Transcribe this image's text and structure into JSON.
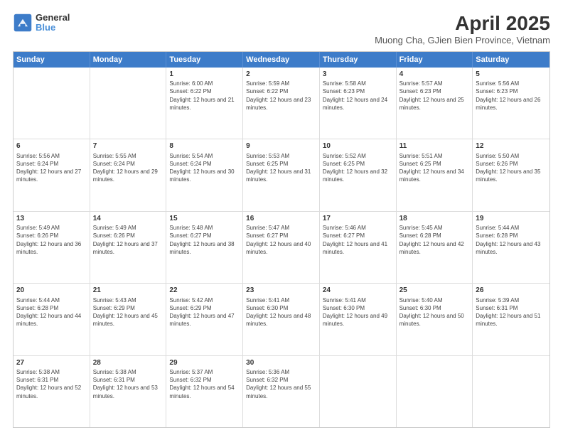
{
  "header": {
    "logo_line1": "General",
    "logo_line2": "Blue",
    "title": "April 2025",
    "subtitle": "Muong Cha, GJien Bien Province, Vietnam"
  },
  "days_of_week": [
    "Sunday",
    "Monday",
    "Tuesday",
    "Wednesday",
    "Thursday",
    "Friday",
    "Saturday"
  ],
  "weeks": [
    [
      {
        "day": "",
        "sunrise": "",
        "sunset": "",
        "daylight": ""
      },
      {
        "day": "",
        "sunrise": "",
        "sunset": "",
        "daylight": ""
      },
      {
        "day": "1",
        "sunrise": "Sunrise: 6:00 AM",
        "sunset": "Sunset: 6:22 PM",
        "daylight": "Daylight: 12 hours and 21 minutes."
      },
      {
        "day": "2",
        "sunrise": "Sunrise: 5:59 AM",
        "sunset": "Sunset: 6:22 PM",
        "daylight": "Daylight: 12 hours and 23 minutes."
      },
      {
        "day": "3",
        "sunrise": "Sunrise: 5:58 AM",
        "sunset": "Sunset: 6:23 PM",
        "daylight": "Daylight: 12 hours and 24 minutes."
      },
      {
        "day": "4",
        "sunrise": "Sunrise: 5:57 AM",
        "sunset": "Sunset: 6:23 PM",
        "daylight": "Daylight: 12 hours and 25 minutes."
      },
      {
        "day": "5",
        "sunrise": "Sunrise: 5:56 AM",
        "sunset": "Sunset: 6:23 PM",
        "daylight": "Daylight: 12 hours and 26 minutes."
      }
    ],
    [
      {
        "day": "6",
        "sunrise": "Sunrise: 5:56 AM",
        "sunset": "Sunset: 6:24 PM",
        "daylight": "Daylight: 12 hours and 27 minutes."
      },
      {
        "day": "7",
        "sunrise": "Sunrise: 5:55 AM",
        "sunset": "Sunset: 6:24 PM",
        "daylight": "Daylight: 12 hours and 29 minutes."
      },
      {
        "day": "8",
        "sunrise": "Sunrise: 5:54 AM",
        "sunset": "Sunset: 6:24 PM",
        "daylight": "Daylight: 12 hours and 30 minutes."
      },
      {
        "day": "9",
        "sunrise": "Sunrise: 5:53 AM",
        "sunset": "Sunset: 6:25 PM",
        "daylight": "Daylight: 12 hours and 31 minutes."
      },
      {
        "day": "10",
        "sunrise": "Sunrise: 5:52 AM",
        "sunset": "Sunset: 6:25 PM",
        "daylight": "Daylight: 12 hours and 32 minutes."
      },
      {
        "day": "11",
        "sunrise": "Sunrise: 5:51 AM",
        "sunset": "Sunset: 6:25 PM",
        "daylight": "Daylight: 12 hours and 34 minutes."
      },
      {
        "day": "12",
        "sunrise": "Sunrise: 5:50 AM",
        "sunset": "Sunset: 6:26 PM",
        "daylight": "Daylight: 12 hours and 35 minutes."
      }
    ],
    [
      {
        "day": "13",
        "sunrise": "Sunrise: 5:49 AM",
        "sunset": "Sunset: 6:26 PM",
        "daylight": "Daylight: 12 hours and 36 minutes."
      },
      {
        "day": "14",
        "sunrise": "Sunrise: 5:49 AM",
        "sunset": "Sunset: 6:26 PM",
        "daylight": "Daylight: 12 hours and 37 minutes."
      },
      {
        "day": "15",
        "sunrise": "Sunrise: 5:48 AM",
        "sunset": "Sunset: 6:27 PM",
        "daylight": "Daylight: 12 hours and 38 minutes."
      },
      {
        "day": "16",
        "sunrise": "Sunrise: 5:47 AM",
        "sunset": "Sunset: 6:27 PM",
        "daylight": "Daylight: 12 hours and 40 minutes."
      },
      {
        "day": "17",
        "sunrise": "Sunrise: 5:46 AM",
        "sunset": "Sunset: 6:27 PM",
        "daylight": "Daylight: 12 hours and 41 minutes."
      },
      {
        "day": "18",
        "sunrise": "Sunrise: 5:45 AM",
        "sunset": "Sunset: 6:28 PM",
        "daylight": "Daylight: 12 hours and 42 minutes."
      },
      {
        "day": "19",
        "sunrise": "Sunrise: 5:44 AM",
        "sunset": "Sunset: 6:28 PM",
        "daylight": "Daylight: 12 hours and 43 minutes."
      }
    ],
    [
      {
        "day": "20",
        "sunrise": "Sunrise: 5:44 AM",
        "sunset": "Sunset: 6:28 PM",
        "daylight": "Daylight: 12 hours and 44 minutes."
      },
      {
        "day": "21",
        "sunrise": "Sunrise: 5:43 AM",
        "sunset": "Sunset: 6:29 PM",
        "daylight": "Daylight: 12 hours and 45 minutes."
      },
      {
        "day": "22",
        "sunrise": "Sunrise: 5:42 AM",
        "sunset": "Sunset: 6:29 PM",
        "daylight": "Daylight: 12 hours and 47 minutes."
      },
      {
        "day": "23",
        "sunrise": "Sunrise: 5:41 AM",
        "sunset": "Sunset: 6:30 PM",
        "daylight": "Daylight: 12 hours and 48 minutes."
      },
      {
        "day": "24",
        "sunrise": "Sunrise: 5:41 AM",
        "sunset": "Sunset: 6:30 PM",
        "daylight": "Daylight: 12 hours and 49 minutes."
      },
      {
        "day": "25",
        "sunrise": "Sunrise: 5:40 AM",
        "sunset": "Sunset: 6:30 PM",
        "daylight": "Daylight: 12 hours and 50 minutes."
      },
      {
        "day": "26",
        "sunrise": "Sunrise: 5:39 AM",
        "sunset": "Sunset: 6:31 PM",
        "daylight": "Daylight: 12 hours and 51 minutes."
      }
    ],
    [
      {
        "day": "27",
        "sunrise": "Sunrise: 5:38 AM",
        "sunset": "Sunset: 6:31 PM",
        "daylight": "Daylight: 12 hours and 52 minutes."
      },
      {
        "day": "28",
        "sunrise": "Sunrise: 5:38 AM",
        "sunset": "Sunset: 6:31 PM",
        "daylight": "Daylight: 12 hours and 53 minutes."
      },
      {
        "day": "29",
        "sunrise": "Sunrise: 5:37 AM",
        "sunset": "Sunset: 6:32 PM",
        "daylight": "Daylight: 12 hours and 54 minutes."
      },
      {
        "day": "30",
        "sunrise": "Sunrise: 5:36 AM",
        "sunset": "Sunset: 6:32 PM",
        "daylight": "Daylight: 12 hours and 55 minutes."
      },
      {
        "day": "",
        "sunrise": "",
        "sunset": "",
        "daylight": ""
      },
      {
        "day": "",
        "sunrise": "",
        "sunset": "",
        "daylight": ""
      },
      {
        "day": "",
        "sunrise": "",
        "sunset": "",
        "daylight": ""
      }
    ]
  ]
}
